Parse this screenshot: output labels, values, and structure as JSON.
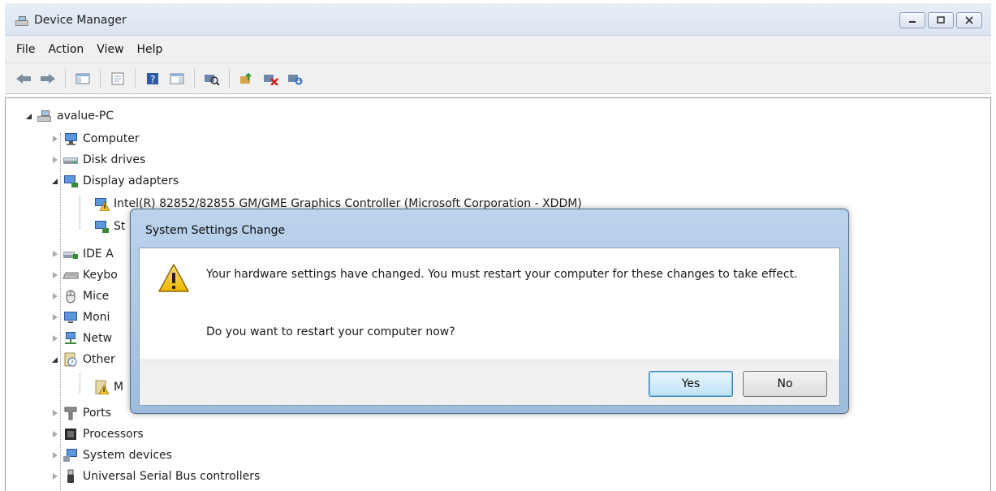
{
  "window": {
    "title": "Device Manager"
  },
  "menu": [
    "File",
    "Action",
    "View",
    "Help"
  ],
  "toolbar": [
    "back-icon",
    "forward-icon",
    "show-hide-console-tree-icon",
    "properties-icon",
    "help-icon",
    "show-hide-action-pane-icon",
    "scan-hardware-icon",
    "update-driver-icon",
    "disable-device-icon",
    "uninstall-device-icon"
  ],
  "tree": {
    "root": "avalue-PC",
    "items": [
      {
        "label": "Computer",
        "icon": "computer-icon"
      },
      {
        "label": "Disk drives",
        "icon": "disk-drive-icon"
      },
      {
        "label": "Display adapters",
        "icon": "display-adapter-icon"
      },
      {
        "label": "Intel(R) 82852/82855 GM/GME Graphics Controller (Microsoft Corporation - XDDM)",
        "icon": "display-adapter-warning-icon"
      },
      {
        "label": "St",
        "icon": "display-adapter-icon"
      },
      {
        "label": "IDE A",
        "icon": "ide-controller-icon"
      },
      {
        "label": "Keybo",
        "icon": "keyboard-icon"
      },
      {
        "label": "Mice",
        "icon": "mouse-icon"
      },
      {
        "label": "Moni",
        "icon": "monitor-icon"
      },
      {
        "label": "Netw",
        "icon": "network-adapter-icon"
      },
      {
        "label": "Other",
        "icon": "other-devices-icon"
      },
      {
        "label": "M",
        "icon": "unknown-device-warning-icon"
      },
      {
        "label": "Ports",
        "icon": "port-icon"
      },
      {
        "label": "Processors",
        "icon": "processor-icon"
      },
      {
        "label": "System devices",
        "icon": "system-devices-icon"
      },
      {
        "label": "Universal Serial Bus controllers",
        "icon": "usb-icon"
      }
    ]
  },
  "dialog": {
    "title": "System Settings Change",
    "message": "Your hardware settings have changed. You must restart your computer for these changes to take effect.",
    "question": "Do you want to restart your computer now?",
    "yes": "Yes",
    "no": "No"
  },
  "colors": {
    "title_bg": "#dbe5f1",
    "dialog_frame": "#a9c4e2",
    "default_button": "#bfe2f9"
  }
}
